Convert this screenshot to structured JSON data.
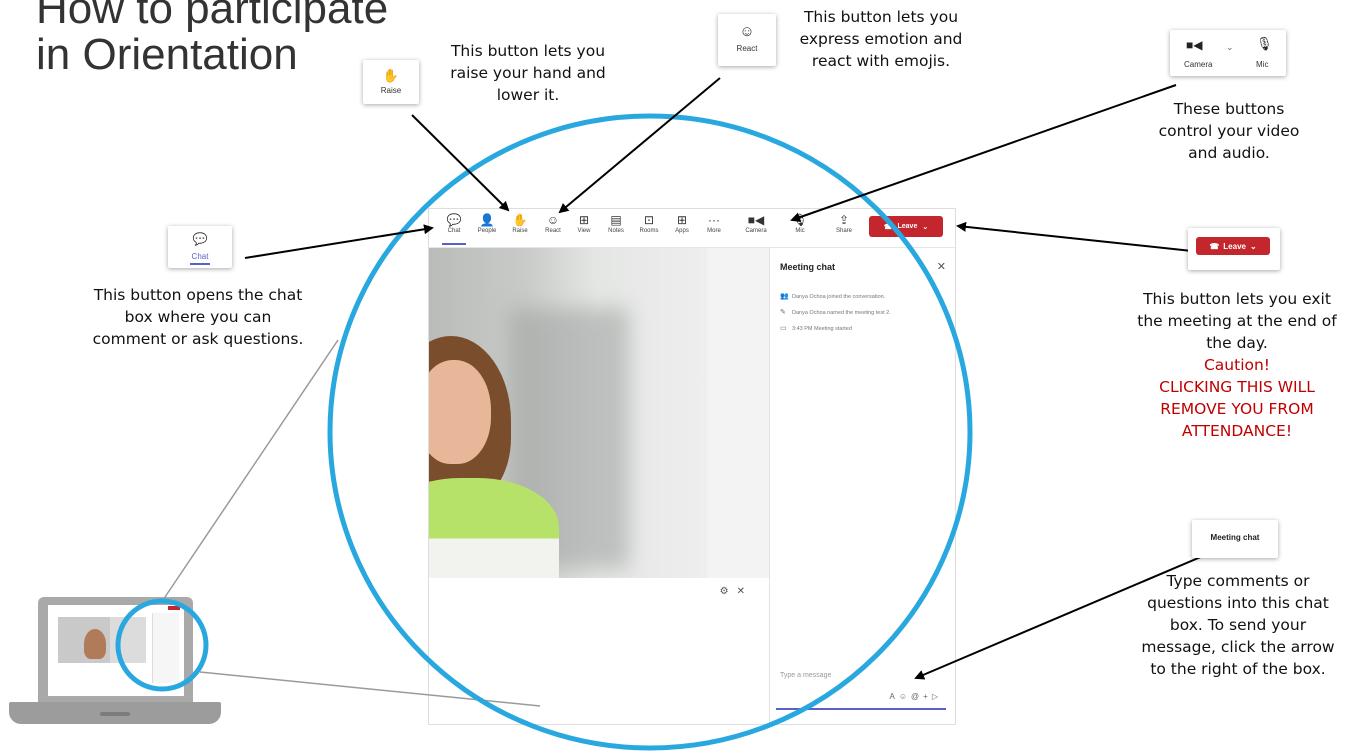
{
  "title": {
    "line1": "How to participate",
    "line2": "in Orientation"
  },
  "notes": {
    "raise": "This button lets you raise your hand and lower it.",
    "react": "This button lets you express emotion and react with emojis.",
    "camera_mic": "These buttons control your video and audio.",
    "chat": "This button opens the chat box where you can comment or ask questions.",
    "leave_main": "This button lets you exit the meeting at the end of the day.",
    "leave_caution": "Caution!",
    "leave_warning": "CLICKING THIS WILL REMOVE YOU FROM ATTENDANCE!",
    "chatbox": "Type comments or questions into this chat box. To send your message, click the arrow to the right of the box."
  },
  "callouts": {
    "raise": "Raise",
    "react": "React",
    "camera": "Camera",
    "mic": "Mic",
    "chat": "Chat",
    "leave": "Leave",
    "meeting_chat": "Meeting chat"
  },
  "toolbar": {
    "items": [
      {
        "label": "Chat",
        "icon": "chat-icon",
        "glyph": "💬"
      },
      {
        "label": "People",
        "icon": "people-icon",
        "glyph": "👤"
      },
      {
        "label": "Raise",
        "icon": "hand-icon",
        "glyph": "✋"
      },
      {
        "label": "React",
        "icon": "smile-icon",
        "glyph": "☺"
      },
      {
        "label": "View",
        "icon": "view-icon",
        "glyph": "⊞"
      },
      {
        "label": "Notes",
        "icon": "notes-icon",
        "glyph": "▤"
      },
      {
        "label": "Rooms",
        "icon": "rooms-icon",
        "glyph": "⊡"
      },
      {
        "label": "Apps",
        "icon": "apps-icon",
        "glyph": "⊞"
      },
      {
        "label": "More",
        "icon": "more-icon",
        "glyph": "···"
      },
      {
        "label": "Camera",
        "icon": "camera-icon",
        "glyph": "■◀"
      },
      {
        "label": "Mic",
        "icon": "mic-icon",
        "glyph": "🎙"
      },
      {
        "label": "Share",
        "icon": "share-icon",
        "glyph": "⇪"
      }
    ],
    "leave_label": "Leave"
  },
  "chat_panel": {
    "title": "Meeting chat",
    "events": [
      "Danya Ochoa joined the conversation.",
      "Danya Ochoa named the meeting test 2.",
      "3:43 PM   Meeting started"
    ],
    "input_placeholder": "Type a message"
  },
  "colors": {
    "accent": "#5b5fc7",
    "leave": "#c4262e",
    "highlight_ring": "#29a8df",
    "warning_text": "#c00000"
  }
}
